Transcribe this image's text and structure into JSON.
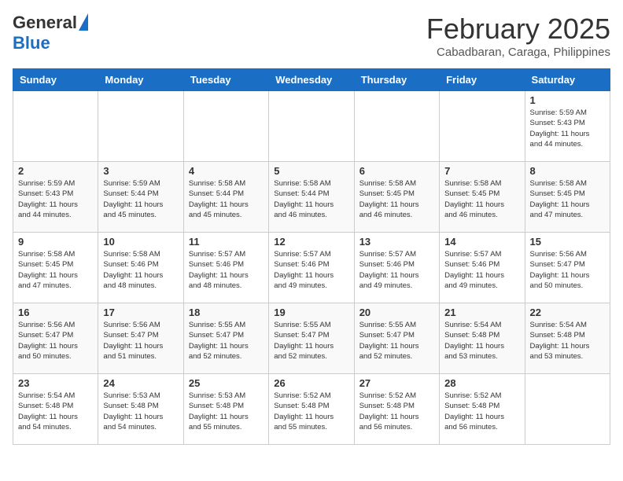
{
  "header": {
    "logo_general": "General",
    "logo_blue": "Blue",
    "month_title": "February 2025",
    "location": "Cabadbaran, Caraga, Philippines"
  },
  "days_of_week": [
    "Sunday",
    "Monday",
    "Tuesday",
    "Wednesday",
    "Thursday",
    "Friday",
    "Saturday"
  ],
  "weeks": [
    [
      {
        "day": "",
        "info": ""
      },
      {
        "day": "",
        "info": ""
      },
      {
        "day": "",
        "info": ""
      },
      {
        "day": "",
        "info": ""
      },
      {
        "day": "",
        "info": ""
      },
      {
        "day": "",
        "info": ""
      },
      {
        "day": "1",
        "info": "Sunrise: 5:59 AM\nSunset: 5:43 PM\nDaylight: 11 hours\nand 44 minutes."
      }
    ],
    [
      {
        "day": "2",
        "info": "Sunrise: 5:59 AM\nSunset: 5:43 PM\nDaylight: 11 hours\nand 44 minutes."
      },
      {
        "day": "3",
        "info": "Sunrise: 5:59 AM\nSunset: 5:44 PM\nDaylight: 11 hours\nand 45 minutes."
      },
      {
        "day": "4",
        "info": "Sunrise: 5:58 AM\nSunset: 5:44 PM\nDaylight: 11 hours\nand 45 minutes."
      },
      {
        "day": "5",
        "info": "Sunrise: 5:58 AM\nSunset: 5:44 PM\nDaylight: 11 hours\nand 46 minutes."
      },
      {
        "day": "6",
        "info": "Sunrise: 5:58 AM\nSunset: 5:45 PM\nDaylight: 11 hours\nand 46 minutes."
      },
      {
        "day": "7",
        "info": "Sunrise: 5:58 AM\nSunset: 5:45 PM\nDaylight: 11 hours\nand 46 minutes."
      },
      {
        "day": "8",
        "info": "Sunrise: 5:58 AM\nSunset: 5:45 PM\nDaylight: 11 hours\nand 47 minutes."
      }
    ],
    [
      {
        "day": "9",
        "info": "Sunrise: 5:58 AM\nSunset: 5:45 PM\nDaylight: 11 hours\nand 47 minutes."
      },
      {
        "day": "10",
        "info": "Sunrise: 5:58 AM\nSunset: 5:46 PM\nDaylight: 11 hours\nand 48 minutes."
      },
      {
        "day": "11",
        "info": "Sunrise: 5:57 AM\nSunset: 5:46 PM\nDaylight: 11 hours\nand 48 minutes."
      },
      {
        "day": "12",
        "info": "Sunrise: 5:57 AM\nSunset: 5:46 PM\nDaylight: 11 hours\nand 49 minutes."
      },
      {
        "day": "13",
        "info": "Sunrise: 5:57 AM\nSunset: 5:46 PM\nDaylight: 11 hours\nand 49 minutes."
      },
      {
        "day": "14",
        "info": "Sunrise: 5:57 AM\nSunset: 5:46 PM\nDaylight: 11 hours\nand 49 minutes."
      },
      {
        "day": "15",
        "info": "Sunrise: 5:56 AM\nSunset: 5:47 PM\nDaylight: 11 hours\nand 50 minutes."
      }
    ],
    [
      {
        "day": "16",
        "info": "Sunrise: 5:56 AM\nSunset: 5:47 PM\nDaylight: 11 hours\nand 50 minutes."
      },
      {
        "day": "17",
        "info": "Sunrise: 5:56 AM\nSunset: 5:47 PM\nDaylight: 11 hours\nand 51 minutes."
      },
      {
        "day": "18",
        "info": "Sunrise: 5:55 AM\nSunset: 5:47 PM\nDaylight: 11 hours\nand 52 minutes."
      },
      {
        "day": "19",
        "info": "Sunrise: 5:55 AM\nSunset: 5:47 PM\nDaylight: 11 hours\nand 52 minutes."
      },
      {
        "day": "20",
        "info": "Sunrise: 5:55 AM\nSunset: 5:47 PM\nDaylight: 11 hours\nand 52 minutes."
      },
      {
        "day": "21",
        "info": "Sunrise: 5:54 AM\nSunset: 5:48 PM\nDaylight: 11 hours\nand 53 minutes."
      },
      {
        "day": "22",
        "info": "Sunrise: 5:54 AM\nSunset: 5:48 PM\nDaylight: 11 hours\nand 53 minutes."
      }
    ],
    [
      {
        "day": "23",
        "info": "Sunrise: 5:54 AM\nSunset: 5:48 PM\nDaylight: 11 hours\nand 54 minutes."
      },
      {
        "day": "24",
        "info": "Sunrise: 5:53 AM\nSunset: 5:48 PM\nDaylight: 11 hours\nand 54 minutes."
      },
      {
        "day": "25",
        "info": "Sunrise: 5:53 AM\nSunset: 5:48 PM\nDaylight: 11 hours\nand 55 minutes."
      },
      {
        "day": "26",
        "info": "Sunrise: 5:52 AM\nSunset: 5:48 PM\nDaylight: 11 hours\nand 55 minutes."
      },
      {
        "day": "27",
        "info": "Sunrise: 5:52 AM\nSunset: 5:48 PM\nDaylight: 11 hours\nand 56 minutes."
      },
      {
        "day": "28",
        "info": "Sunrise: 5:52 AM\nSunset: 5:48 PM\nDaylight: 11 hours\nand 56 minutes."
      },
      {
        "day": "",
        "info": ""
      }
    ]
  ]
}
